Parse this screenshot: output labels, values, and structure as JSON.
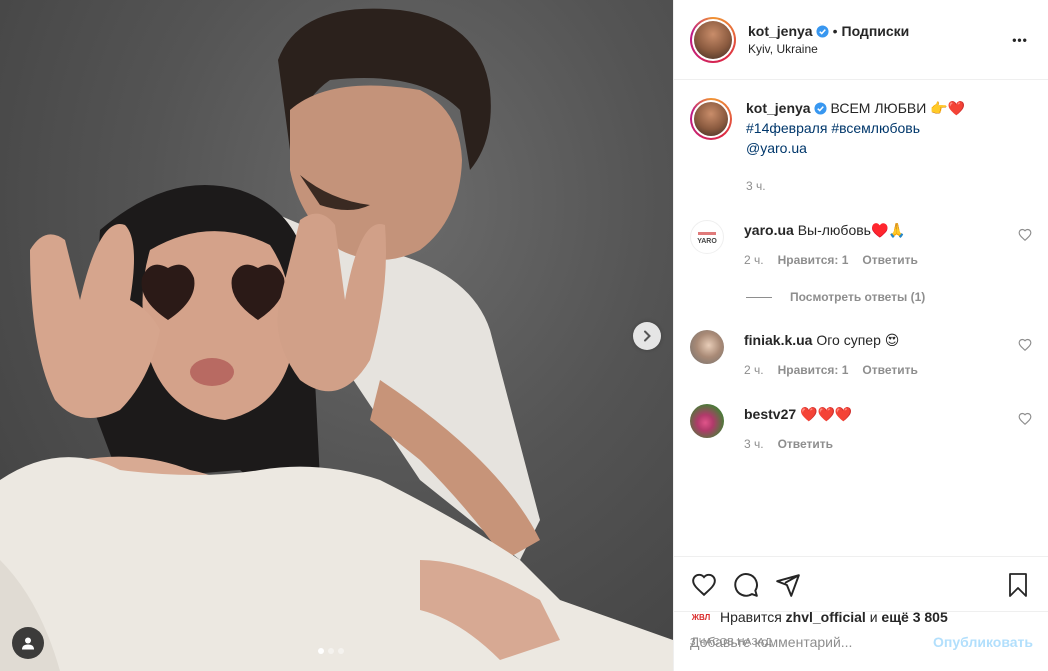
{
  "post": {
    "author": "kot_jenya",
    "follow_separator": "•",
    "follow_label": "Подписки",
    "location": "Kyiv, Ukraine",
    "more_label": "•••",
    "carousel_active_index": 0,
    "carousel_count": 3
  },
  "caption": {
    "user": "kot_jenya",
    "text": "ВСЕМ ЛЮБВИ 👉❤️",
    "hashtags": "#14февраля #всемлюбовь",
    "mention": "@yaro.ua",
    "time": "3 ч."
  },
  "comments": [
    {
      "user": "yaro.ua",
      "text": "Вы-любовь♥️🙏",
      "time": "2 ч.",
      "likes": "Нравится: 1",
      "reply": "Ответить",
      "avatar": "yaro-logo",
      "view_replies": "Посмотреть ответы (1)"
    },
    {
      "user": "finiak.k.ua",
      "text": "Ого супер 😍",
      "time": "2 ч.",
      "likes": "Нравится: 1",
      "reply": "Ответить",
      "avatar": "woman-photo"
    },
    {
      "user": "bestv27",
      "text": "❤️❤️❤️",
      "time": "3 ч.",
      "reply": "Ответить",
      "avatar": "flower-photo"
    }
  ],
  "likes": {
    "prefix": "Нравится",
    "user": "zhvl_official",
    "conjunction": "и",
    "more": "ещё 3 805"
  },
  "timestamp": "3 часов назад",
  "add_comment": {
    "placeholder": "Добавьте комментарий...",
    "publish": "Опубликовать"
  },
  "colors": {
    "accent": "#3897f0",
    "publish_disabled": "#b2dffc",
    "muted": "#8e8e8e",
    "tag": "#00376b"
  },
  "icons": [
    "verified-icon",
    "more-icon",
    "chevron-right-icon",
    "user-tag-icon",
    "heart-icon",
    "comment-icon",
    "share-icon",
    "bookmark-icon"
  ]
}
